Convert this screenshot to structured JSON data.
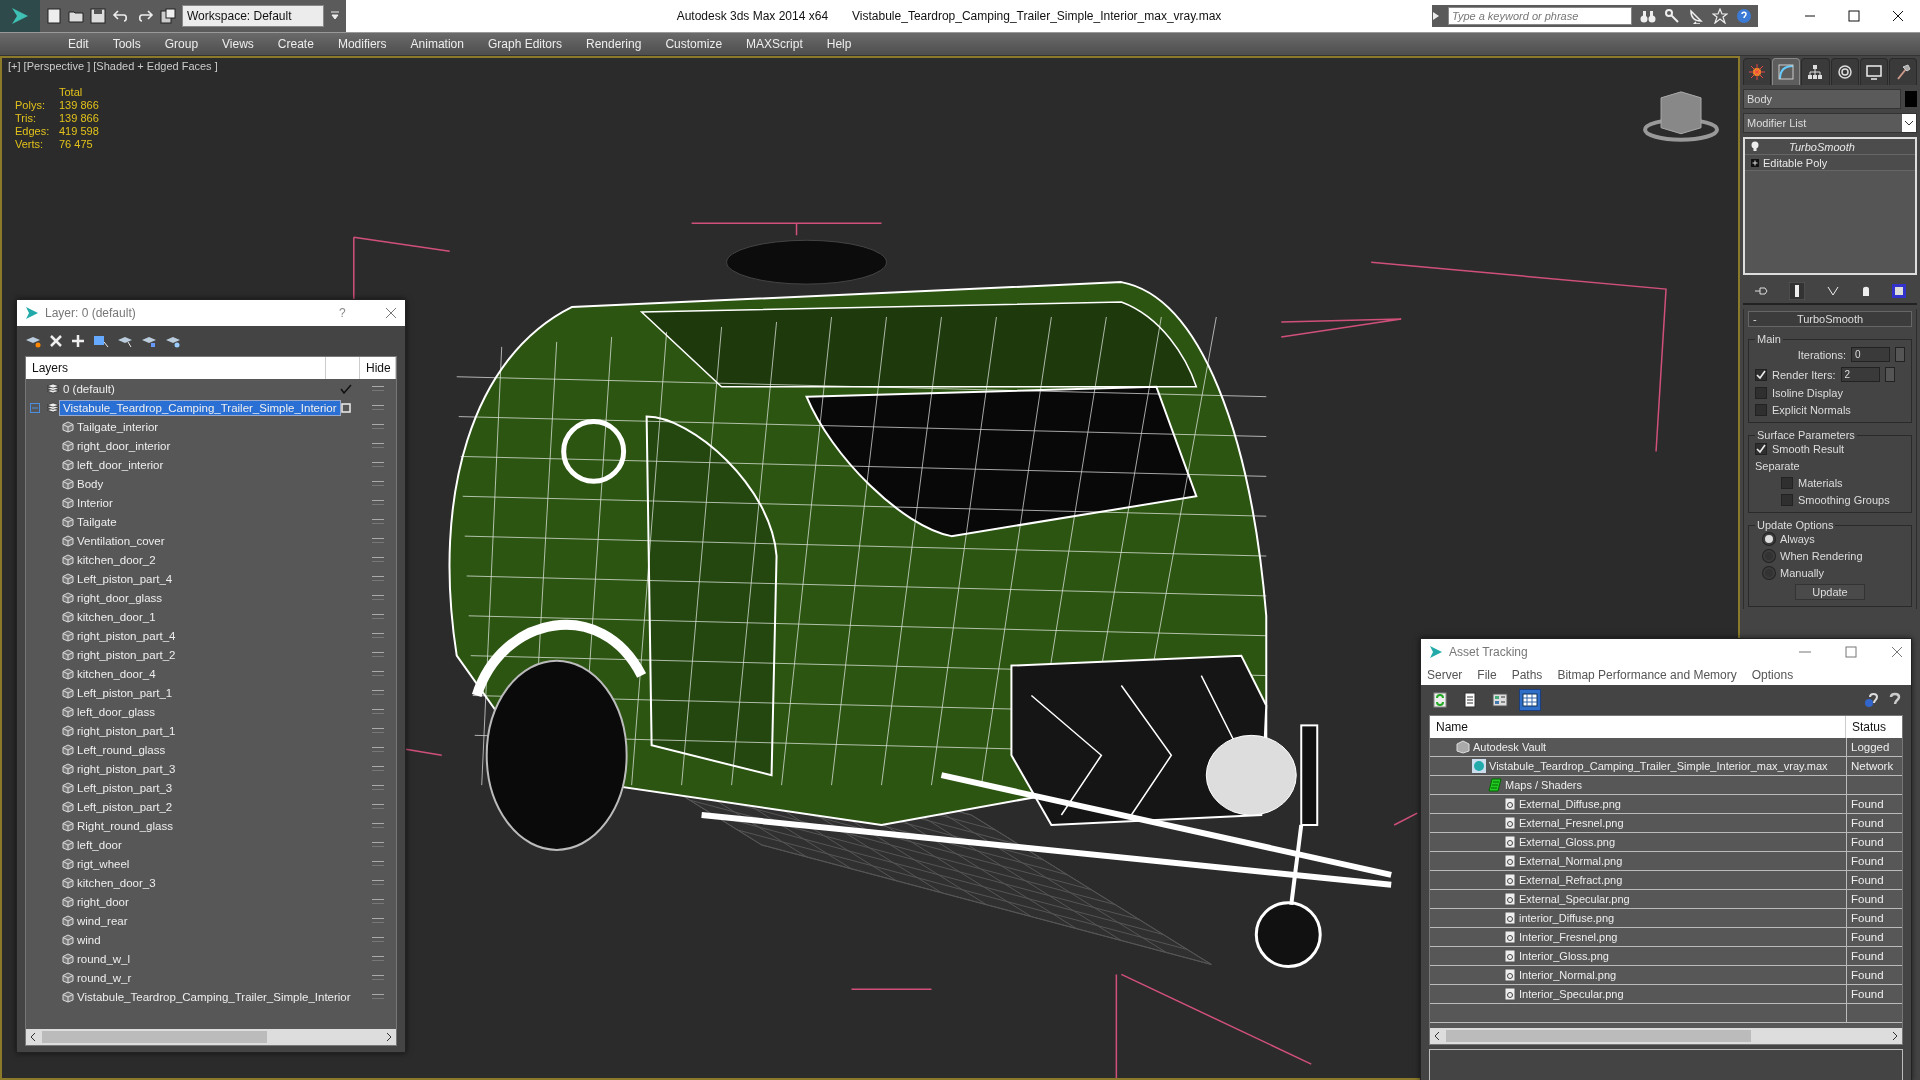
{
  "title_bar": {
    "workspace": "Workspace: Default",
    "app": "Autodesk 3ds Max  2014 x64",
    "file": "Vistabule_Teardrop_Camping_Trailer_Simple_Interior_max_vray.max",
    "search_placeholder": "Type a keyword or phrase"
  },
  "menu": [
    "Edit",
    "Tools",
    "Group",
    "Views",
    "Create",
    "Modifiers",
    "Animation",
    "Graph Editors",
    "Rendering",
    "Customize",
    "MAXScript",
    "Help"
  ],
  "viewport": {
    "label": "[+] [Perspective ] [Shaded + Edged Faces ]",
    "stats_header": "Total",
    "stats": [
      {
        "label": "Polys:",
        "value": "139 866"
      },
      {
        "label": "Tris:",
        "value": "139 866"
      },
      {
        "label": "Edges:",
        "value": "419 598"
      },
      {
        "label": "Verts:",
        "value": "76 475"
      }
    ]
  },
  "layer_window": {
    "title": "Layer: 0 (default)",
    "help": "?",
    "columns": [
      "Layers",
      "Hide"
    ],
    "layers": [
      {
        "name": "0 (default)",
        "selected": false,
        "current": true
      },
      {
        "name": "Vistabule_Teardrop_Camping_Trailer_Simple_Interior",
        "selected": true,
        "current": false,
        "expanded": true,
        "children": [
          "Tailgate_interior",
          "right_door_interior",
          "left_door_interior",
          "Body",
          "Interior",
          "Tailgate",
          "Ventilation_cover",
          "kitchen_door_2",
          "Left_piston_part_4",
          "right_door_glass",
          "kitchen_door_1",
          "right_piston_part_4",
          "right_piston_part_2",
          "kitchen_door_4",
          "Left_piston_part_1",
          "left_door_glass",
          "right_piston_part_1",
          "Left_round_glass",
          "right_piston_part_3",
          "Left_piston_part_3",
          "Left_piston_part_2",
          "Right_round_glass",
          "left_door",
          "rigt_wheel",
          "kitchen_door_3",
          "right_door",
          "wind_rear",
          "wind",
          "round_w_l",
          "round_w_r",
          "Vistabule_Teardrop_Camping_Trailer_Simple_Interior"
        ]
      }
    ]
  },
  "command_panel": {
    "tabs": [
      {
        "kind": "create",
        "selected": false
      },
      {
        "kind": "modify",
        "selected": true
      },
      {
        "kind": "hierarchy",
        "selected": false
      },
      {
        "kind": "motion",
        "selected": false
      },
      {
        "kind": "display",
        "selected": false
      },
      {
        "kind": "utilities",
        "selected": false
      }
    ],
    "object_name": "Body",
    "modifier_list": "Modifier List",
    "stack": [
      {
        "name": "TurboSmooth",
        "kind": "modifier"
      },
      {
        "name": "Editable Poly",
        "kind": "base"
      }
    ],
    "rollout": {
      "toggle": "-",
      "title": "TurboSmooth",
      "groups": [
        {
          "title": "Main",
          "items": [
            {
              "kind": "spinner",
              "label": "Iterations:",
              "value": "0"
            },
            {
              "kind": "check_spinner",
              "label": "Render Iters:",
              "value": "2",
              "checked": true
            },
            {
              "kind": "checkbox",
              "label": "Isoline Display",
              "checked": false
            },
            {
              "kind": "checkbox",
              "label": "Explicit Normals",
              "checked": false
            }
          ]
        },
        {
          "title": "Surface Parameters",
          "items": [
            {
              "kind": "checkbox",
              "label": "Smooth Result",
              "checked": true
            },
            {
              "kind": "label",
              "label": "Separate"
            },
            {
              "kind": "sub_checkbox",
              "label": "Materials",
              "checked": false
            },
            {
              "kind": "sub_checkbox",
              "label": "Smoothing Groups",
              "checked": false
            }
          ]
        },
        {
          "title": "Update Options",
          "items": [
            {
              "kind": "radio",
              "label": "Always",
              "selected": true
            },
            {
              "kind": "radio",
              "label": "When Rendering",
              "selected": false
            },
            {
              "kind": "radio",
              "label": "Manually",
              "selected": false
            },
            {
              "kind": "button",
              "label": "Update"
            }
          ]
        }
      ]
    }
  },
  "asset_tracking": {
    "title": "Asset Tracking",
    "menu": [
      "Server",
      "File",
      "Paths",
      "Bitmap Performance and Memory",
      "Options"
    ],
    "toolbar": [
      {
        "kind": "refresh",
        "selected": false
      },
      {
        "kind": "list",
        "selected": false
      },
      {
        "kind": "thumbnails",
        "selected": false
      },
      {
        "kind": "table",
        "selected": true
      }
    ],
    "columns": [
      "Name",
      "Status"
    ],
    "rows": [
      {
        "kind": "vault",
        "name": "Autodesk Vault",
        "status": "Logged",
        "children": [
          {
            "kind": "max",
            "name": "Vistabule_Teardrop_Camping_Trailer_Simple_Interior_max_vray.max",
            "status": "Network",
            "children": [
              {
                "kind": "folder",
                "name": "Maps / Shaders",
                "children": [
                  {
                    "kind": "bitmap",
                    "name": "External_Diffuse.png",
                    "status": "Found"
                  },
                  {
                    "kind": "bitmap",
                    "name": "External_Fresnel.png",
                    "status": "Found"
                  },
                  {
                    "kind": "bitmap",
                    "name": "External_Gloss.png",
                    "status": "Found"
                  },
                  {
                    "kind": "bitmap",
                    "name": "External_Normal.png",
                    "status": "Found"
                  },
                  {
                    "kind": "bitmap",
                    "name": "External_Refract.png",
                    "status": "Found"
                  },
                  {
                    "kind": "bitmap",
                    "name": "External_Specular.png",
                    "status": "Found"
                  },
                  {
                    "kind": "bitmap",
                    "name": "interior_Diffuse.png",
                    "status": "Found"
                  },
                  {
                    "kind": "bitmap",
                    "name": "Interior_Fresnel.png",
                    "status": "Found"
                  },
                  {
                    "kind": "bitmap",
                    "name": "Interior_Gloss.png",
                    "status": "Found"
                  },
                  {
                    "kind": "bitmap",
                    "name": "Interior_Normal.png",
                    "status": "Found"
                  },
                  {
                    "kind": "bitmap",
                    "name": "Interior_Specular.png",
                    "status": "Found"
                  }
                ]
              }
            ]
          }
        ]
      }
    ]
  }
}
